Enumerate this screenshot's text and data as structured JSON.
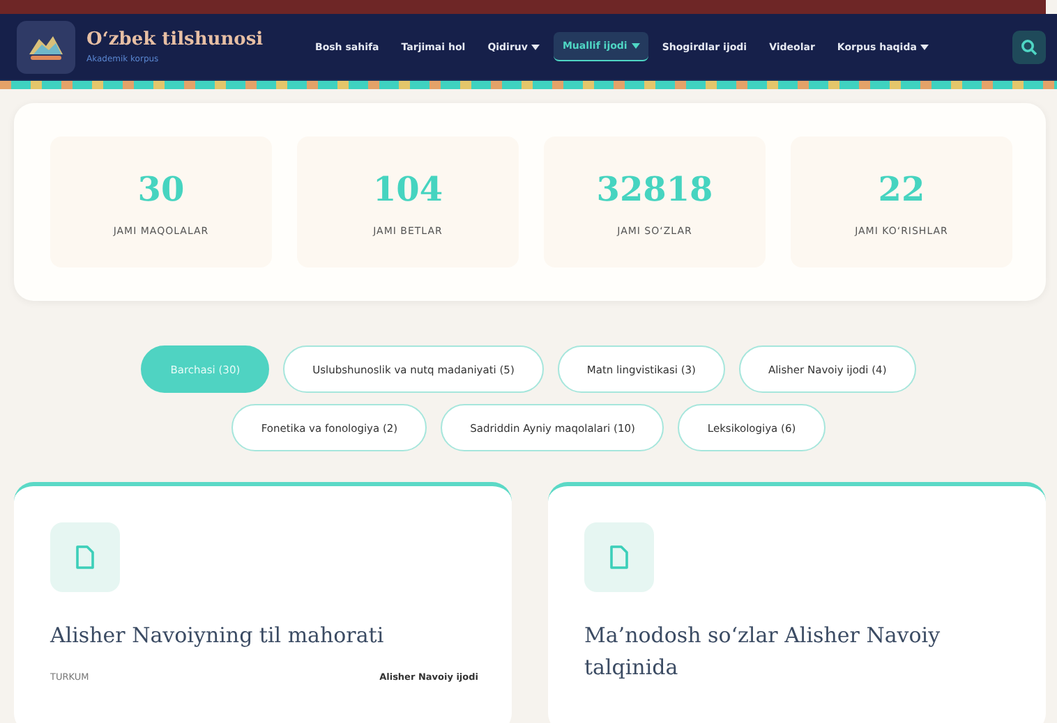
{
  "brand": {
    "title": "O‘zbek tilshunosi",
    "subtitle": "Akademik korpus"
  },
  "nav": [
    {
      "label": "Bosh sahifa",
      "dropdown": false,
      "selected": false
    },
    {
      "label": "Tarjimai hol",
      "dropdown": false,
      "selected": false
    },
    {
      "label": "Qidiruv",
      "dropdown": true,
      "selected": false
    },
    {
      "label": "Muallif ijodi",
      "dropdown": true,
      "selected": true
    },
    {
      "label": "Shogirdlar ijodi",
      "dropdown": false,
      "selected": false
    },
    {
      "label": "Videolar",
      "dropdown": false,
      "selected": false
    },
    {
      "label": "Korpus haqida",
      "dropdown": true,
      "selected": false
    }
  ],
  "stats": [
    {
      "value": "30",
      "label": "JAMI MAQOLALAR"
    },
    {
      "value": "104",
      "label": "JAMI BETLAR"
    },
    {
      "value": "32818",
      "label": "JAMI SO‘ZLAR"
    },
    {
      "value": "22",
      "label": "JAMI KO‘RISHLAR"
    }
  ],
  "filters": [
    [
      {
        "label": "Barchasi (30)",
        "selected": true
      },
      {
        "label": "Uslubshunoslik va nutq madaniyati (5)",
        "selected": false
      },
      {
        "label": "Matn lingvistikasi (3)",
        "selected": false
      },
      {
        "label": "Alisher Navoiy ijodi (4)",
        "selected": false
      }
    ],
    [
      {
        "label": "Fonetika va fonologiya (2)",
        "selected": false
      },
      {
        "label": "Sadriddin Ayniy maqolalari (10)",
        "selected": false
      },
      {
        "label": "Leksikologiya (6)",
        "selected": false
      }
    ]
  ],
  "articles": [
    {
      "title": "Alisher Navoiyning til mahorati",
      "meta_label": "TURKUM",
      "meta_value": "Alisher Navoiy ijodi"
    },
    {
      "title": "Ma’nodosh so‘zlar Alisher Navoiy talqinida"
    }
  ]
}
